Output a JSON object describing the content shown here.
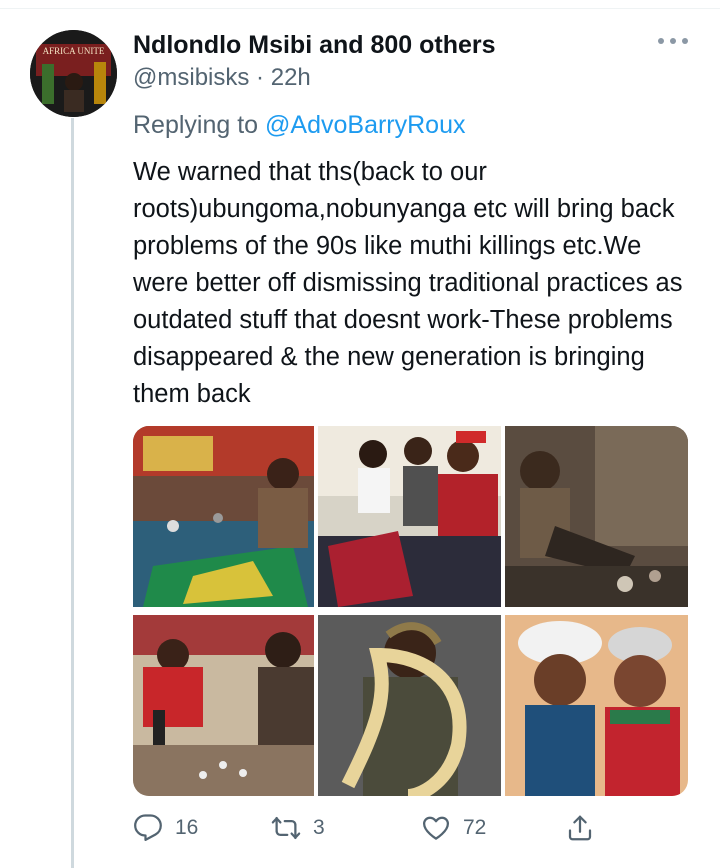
{
  "tweet": {
    "author": {
      "display_name": "Ndlondlo Msibi and 800 others",
      "handle": "@msibisks",
      "age": "22h",
      "avatar_text": "AFRICA UNITE"
    },
    "replying_label": "Replying to",
    "replying_to": "@AdvoBarryRoux",
    "text": "We warned that ths(back to our roots)ubungoma,nobunyanga etc will bring back problems of the 90s like muthi killings etc.We were better off dismissing traditional practices as outdated stuff that doesnt work-These problems disappeared & the new generation is bringing them back",
    "stats": {
      "replies": "16",
      "retweets": "3",
      "likes": "72"
    },
    "colors": {
      "link": "#1d9bf0",
      "secondary_text": "#536471",
      "thread_line": "#cfd9de"
    }
  },
  "separator": "·",
  "icons": [
    "more-icon",
    "reply-icon",
    "retweet-icon",
    "like-icon",
    "share-icon"
  ]
}
